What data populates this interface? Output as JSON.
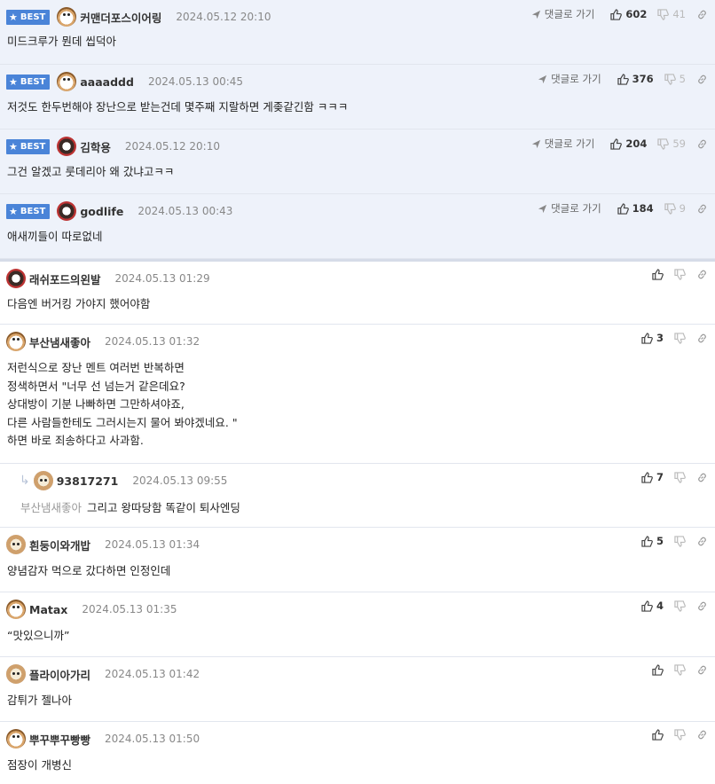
{
  "ui": {
    "best_label": "BEST",
    "reply_label": "댓글로 가기"
  },
  "best": [
    {
      "nick": "커맨더포스이어링",
      "date": "2024.05.12 20:10",
      "text": "미드크루가 뭔데 씹덕아",
      "up": "602",
      "down": "41",
      "avatar": "cat-icon"
    },
    {
      "nick": "aaaaddd",
      "date": "2024.05.13 00:45",
      "text": "저것도 한두번해야 장난으로 받는건데 몇주째 지랄하면 게좆같긴함 ㅋㅋㅋ",
      "up": "376",
      "down": "5",
      "avatar": "cat-icon"
    },
    {
      "nick": "김학용",
      "date": "2024.05.12 20:10",
      "text": "그건 알겠고 룻데리아 왜 갔냐고ㅋㅋ",
      "up": "204",
      "down": "59",
      "avatar": "bear-icon"
    },
    {
      "nick": "godlife",
      "date": "2024.05.13 00:43",
      "text": "애새끼들이 따로없네",
      "up": "184",
      "down": "9",
      "avatar": "bear-icon"
    }
  ],
  "comments": [
    {
      "nick": "래쉬포드의왼발",
      "date": "2024.05.13 01:29",
      "lines": [
        "다음엔 버거킹 가야지 했어야함"
      ],
      "up": "",
      "avatar": "bear-icon"
    },
    {
      "nick": "부산냄새좋아",
      "date": "2024.05.13 01:32",
      "lines": [
        "저런식으로 장난 멘트 여러번 반복하면",
        "정색하면서 \"너무 선 넘는거 같은데요?",
        "상대방이 기분 나빠하면 그만하셔야죠,",
        "다른 사람들한테도 그러시는지 물어 봐야겠네요. \"",
        "하면 바로 죄송하다고 사과함."
      ],
      "up": "3",
      "avatar": "cat-icon"
    },
    {
      "nick": "93817271",
      "date": "2024.05.13 09:55",
      "mention": "부산냄새좋아",
      "lines": [
        "그리고 왕따당함 똑같이 퇴사엔딩"
      ],
      "up": "7",
      "avatar": "dog-icon",
      "reply": true
    },
    {
      "nick": "흰둥이와개밥",
      "date": "2024.05.13 01:34",
      "lines": [
        "양념감자 먹으로 갔다하면 인정인데"
      ],
      "up": "5",
      "avatar": "dog-icon"
    },
    {
      "nick": "Matax",
      "date": "2024.05.13 01:35",
      "lines": [
        "“맛있으니까”"
      ],
      "up": "4",
      "avatar": "cat-icon"
    },
    {
      "nick": "플라이아가리",
      "date": "2024.05.13 01:42",
      "lines": [
        "감튀가 젤나아"
      ],
      "up": "",
      "avatar": "dog-icon"
    },
    {
      "nick": "뿌꾸뿌꾸빵빵",
      "date": "2024.05.13 01:50",
      "lines": [
        "점장이 개병신"
      ],
      "up": "",
      "avatar": "cat-icon"
    }
  ]
}
